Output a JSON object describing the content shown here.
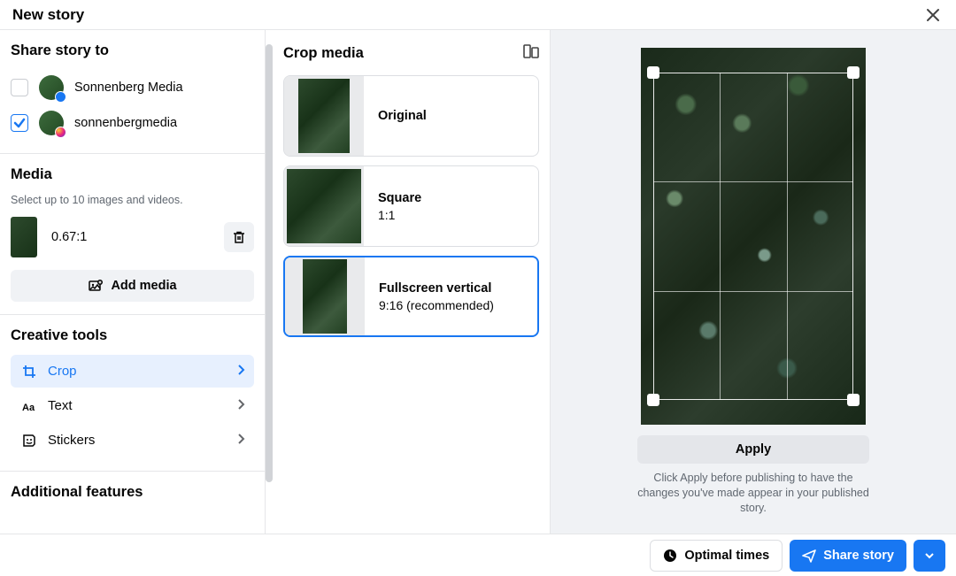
{
  "header": {
    "title": "New story"
  },
  "sidebar": {
    "share_title": "Share story to",
    "accounts": [
      {
        "name": "Sonnenberg Media",
        "checked": false,
        "platform": "fb"
      },
      {
        "name": "sonnenbergmedia",
        "checked": true,
        "platform": "ig"
      }
    ],
    "media_title": "Media",
    "media_sub": "Select up to 10 images and videos.",
    "media_item": {
      "ratio": "0.67:1"
    },
    "add_media_label": "Add media",
    "tools_title": "Creative tools",
    "tools": [
      {
        "label": "Crop",
        "active": true
      },
      {
        "label": "Text",
        "active": false
      },
      {
        "label": "Stickers",
        "active": false
      }
    ],
    "additional_title": "Additional features"
  },
  "crop_panel": {
    "title": "Crop media",
    "options": [
      {
        "name": "Original",
        "ratio": "",
        "selected": false,
        "shape": "original"
      },
      {
        "name": "Square",
        "ratio": "1:1",
        "selected": false,
        "shape": "square"
      },
      {
        "name": "Fullscreen vertical",
        "ratio": "9:16 (recommended)",
        "selected": true,
        "shape": "vertical"
      }
    ]
  },
  "preview": {
    "apply_label": "Apply",
    "apply_note": "Click Apply before publishing to have the changes you've made appear in your published story."
  },
  "footer": {
    "optimal_label": "Optimal times",
    "share_label": "Share story"
  },
  "colors": {
    "primary": "#1877f2"
  }
}
